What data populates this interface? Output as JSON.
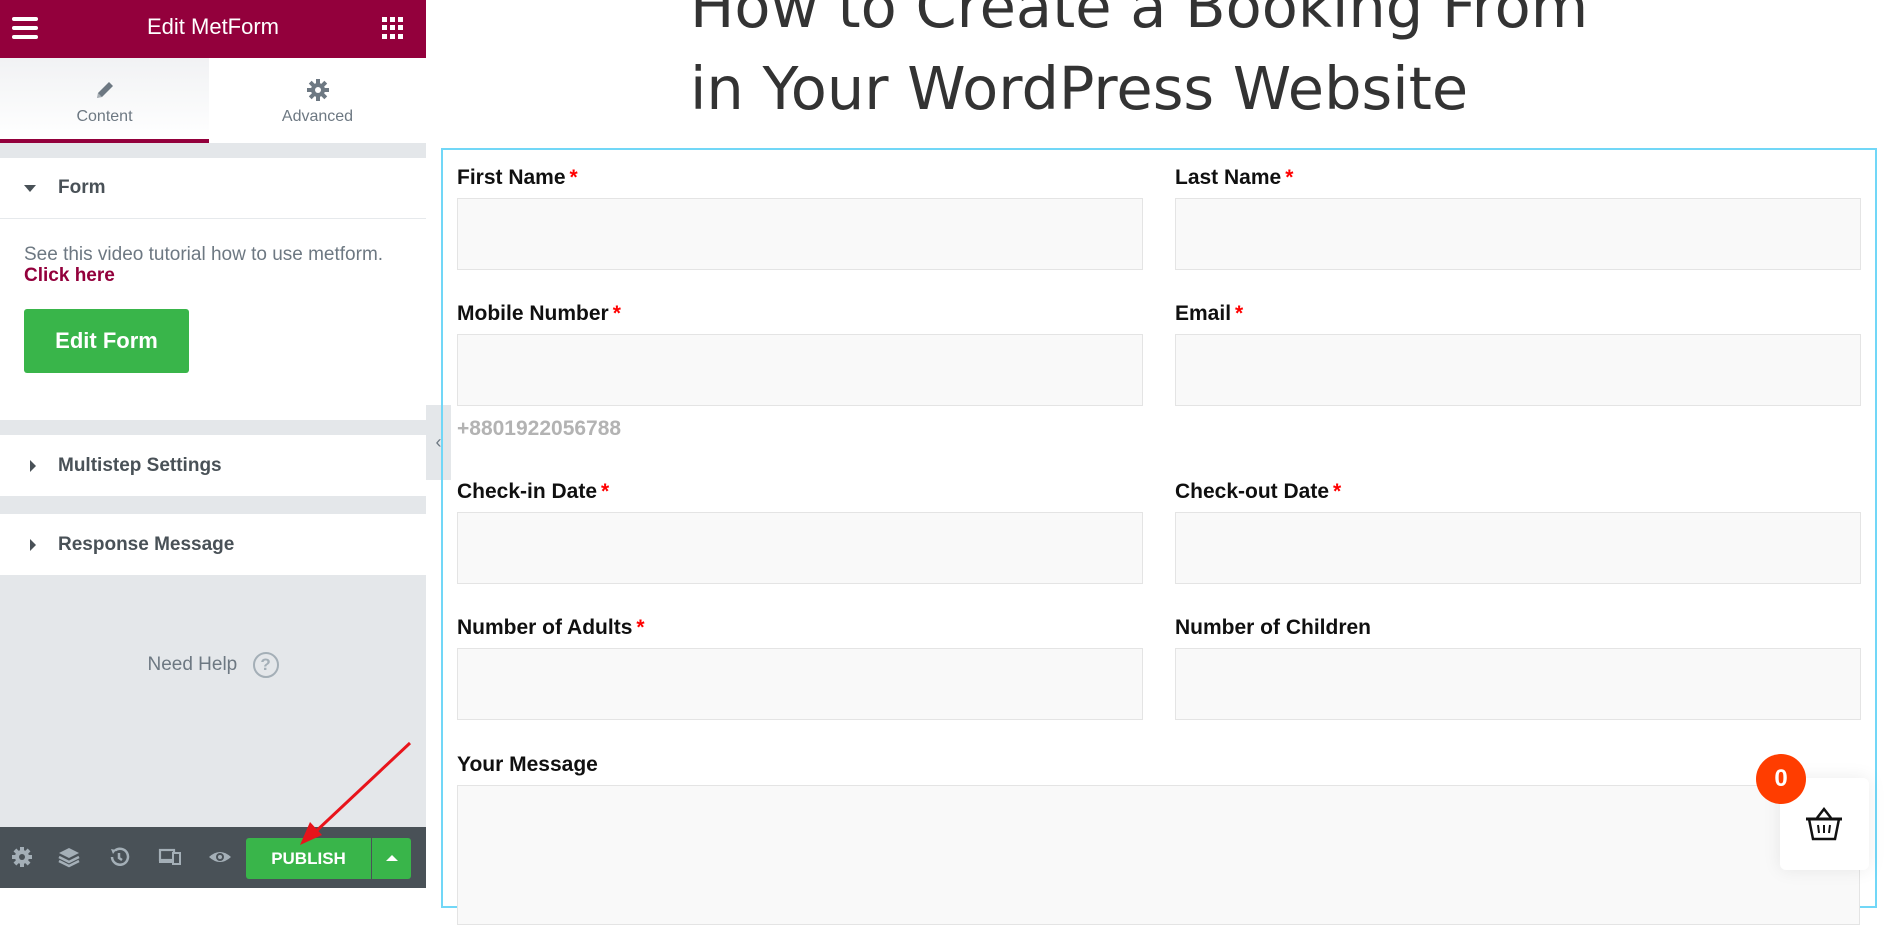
{
  "sidebar": {
    "header_title": "Edit MetForm",
    "tabs": [
      {
        "label": "Content",
        "icon": "pencil-icon",
        "active": true
      },
      {
        "label": "Advanced",
        "icon": "gear-icon",
        "active": false
      }
    ],
    "sections": {
      "form": {
        "title": "Form",
        "description": "See this video tutorial how to use metform.",
        "link_label": "Click here",
        "button_label": "Edit Form"
      },
      "multistep": {
        "title": "Multistep Settings"
      },
      "response": {
        "title": "Response Message"
      }
    },
    "need_help_label": "Need Help",
    "footer": {
      "icons": [
        "settings-icon",
        "navigator-layers-icon",
        "history-icon",
        "responsive-mode-icon",
        "preview-eye-icon"
      ],
      "publish_label": "PUBLISH"
    }
  },
  "page": {
    "title_line1": "How to Create a Booking From",
    "title_line2": "in Your WordPress Website"
  },
  "form": {
    "fields": [
      {
        "label": "First Name",
        "required": true,
        "value": ""
      },
      {
        "label": "Last Name",
        "required": true,
        "value": ""
      },
      {
        "label": "Mobile Number",
        "required": true,
        "value": "",
        "hint": "+8801922056788"
      },
      {
        "label": "Email",
        "required": true,
        "value": ""
      },
      {
        "label": "Check-in Date",
        "required": true,
        "value": ""
      },
      {
        "label": "Check-out Date",
        "required": true,
        "value": ""
      },
      {
        "label": "Number of Adults",
        "required": true,
        "value": ""
      },
      {
        "label": "Number of Children",
        "required": false,
        "value": ""
      },
      {
        "label": "Your Message",
        "required": false,
        "value": ""
      }
    ],
    "required_marker": "*"
  },
  "cart": {
    "count": "0",
    "icon": "shopping-basket-icon"
  },
  "colors": {
    "brand": "#93003c",
    "publish_green": "#39b54a",
    "cart_badge": "#ff3d00",
    "form_border": "#71d7f7",
    "annotation_arrow": "#e8141b"
  }
}
